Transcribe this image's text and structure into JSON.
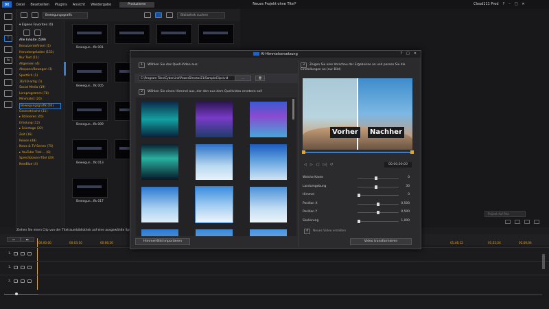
{
  "app": {
    "logo_text": "DX",
    "menu": [
      "Datei",
      "Bearbeiten",
      "Plugins",
      "Ansicht",
      "Wiedergabe"
    ],
    "produce_label": "Produzieren",
    "project_title": "Neues Projekt ohne Titel*",
    "user": "Cloud111 Prod",
    "window_controls": [
      "?",
      "–",
      "□",
      "✕"
    ]
  },
  "library": {
    "category_select": "Bewegungsgrafik",
    "search_placeholder": "Bibliothek suchen",
    "favorites_label": "▾ Eigene Favoriten (0)",
    "all_label": "Alle Inhalte (539)",
    "categories": [
      "Benutzerdefiniert (1)",
      "Heruntergeladen (153)",
      "Nur Text (11)",
      "Allgemein (4)",
      "Abspann/Bewegen (1)",
      "Sportlich (1)",
      "3D/3D-artig (1)",
      "Social Media (19)",
      "Lernprogramm (78)",
      "Minimalist (20)",
      "Bewegungsgrafik (44)",
      "Geometrische (31)",
      "▸ Stilisieren (45)",
      "Erholung (12)",
      "▸ Feiertage (22)",
      "Zeit (16)",
      "Reisen (48)",
      "News & TV-Serien (75)",
      "▸ YouTube Titel-... (8)",
      "Sprechblasen-Titel (20)",
      "NewBlue (4)"
    ],
    "thumb_labels": [
      "Bewegun...fik 001",
      "Bewegun...fik 005",
      "Bewegun...fik 009",
      "Bewegun...fik 013",
      "Bewegun...fik 017"
    ]
  },
  "preview": {
    "dropdown": "Projekt Auf Pikt",
    "hint": "Ziehen Sie einen Clip von der Titelraumbibliothek auf eine ausgewählte Spur"
  },
  "timeline": {
    "ticks": [
      "00;00;00",
      "00;03;10",
      "00;06;20",
      "00;10;00",
      "01;40;02",
      "01;46;12",
      "01;52;24",
      "02;00;04"
    ],
    "tracks": [
      "1.",
      "1.",
      "2."
    ]
  },
  "dialog": {
    "title": "AI-Himmelsersetzung",
    "step1_num": "1",
    "step1": "Wählen Sie das Quell-Video aus:",
    "path": "C:\\Program Files\\CyberLink\\PowerDirector21\\SampleClips\\vid",
    "browse_label": "…",
    "delete_label": "🗑",
    "step2_num": "2",
    "step2": "Wählen Sie einen Himmel aus, der den aus dem Quellvideo ersetzen soll",
    "import_label": "Himmel-Bild importieren",
    "step3_num": "3",
    "step3": "Zeigen Sie eine Vorschau der Ergebnisse an und passen Sie die Einstellungen an (nur Bild)",
    "before_label": "Vorher",
    "after_label": "Nachher",
    "timecode": "00;00;00;00",
    "params": [
      {
        "label": "Weiche Kante",
        "value": "0",
        "pos": 0.45
      },
      {
        "label": "Landumgebung",
        "value": "30",
        "pos": 0.45
      },
      {
        "label": "Himmel",
        "value": "0",
        "pos": 0.0
      },
      {
        "label": "Position X",
        "value": "0,500",
        "pos": 0.5
      },
      {
        "label": "Position Y",
        "value": "0,500",
        "pos": 0.5
      },
      {
        "label": "Skalierung",
        "value": "1,000",
        "pos": 0.0
      }
    ],
    "step4_num": "4",
    "step4": "Neues Video erstellen",
    "transform_label": "Video transformieren",
    "colors": {
      "accent": "#2f7fe0",
      "orange": "#e3a52a"
    }
  }
}
